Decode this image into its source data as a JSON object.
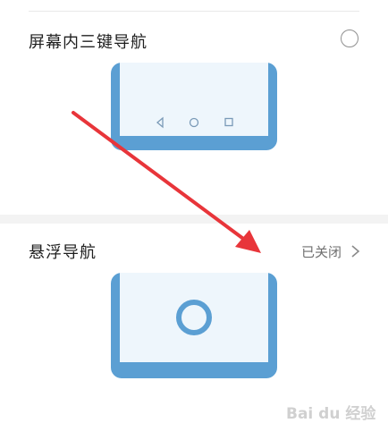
{
  "options": {
    "three_key": {
      "label": "屏幕内三键导航"
    },
    "floating": {
      "label": "悬浮导航",
      "status": "已关闭"
    }
  },
  "watermark": "Bai du 经验",
  "colors": {
    "phone_blue": "#5b9fd3",
    "phone_screen": "#eef6fc",
    "arrow_red": "#e8353a"
  }
}
